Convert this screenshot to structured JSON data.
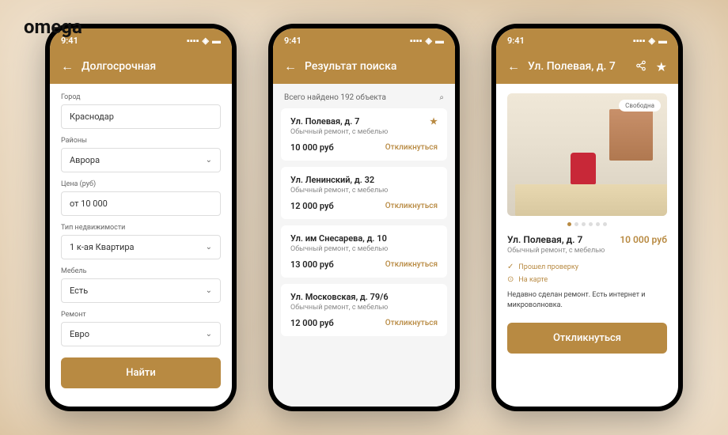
{
  "logo": "omega",
  "status": {
    "time": "9:41"
  },
  "screen1": {
    "title": "Долгосрочная",
    "fields": {
      "city": {
        "label": "Город",
        "value": "Краснодар"
      },
      "district": {
        "label": "Районы",
        "value": "Аврора"
      },
      "price": {
        "label": "Цена (руб)",
        "value": "от 10 000"
      },
      "type": {
        "label": "Тип недвижимости",
        "value": "1 к-ая Квартира"
      },
      "furniture": {
        "label": "Мебель",
        "value": "Есть"
      },
      "renovation": {
        "label": "Ремонт",
        "value": "Евро"
      }
    },
    "submit": "Найти"
  },
  "screen2": {
    "title": "Результат поиска",
    "summary": "Всего найдено 192 объекта",
    "items": [
      {
        "title": "Ул. Полевая, д. 7",
        "sub": "Обычный ремонт, с мебелью",
        "price": "10 000 руб",
        "action": "Откликнуться",
        "starred": true
      },
      {
        "title": "Ул. Ленинский, д. 32",
        "sub": "Обычный ремонт, с мебелью",
        "price": "12 000 руб",
        "action": "Откликнуться",
        "starred": false
      },
      {
        "title": "Ул. им Снесарева, д. 10",
        "sub": "Обычный ремонт, с мебелью",
        "price": "13 000 руб",
        "action": "Откликнуться",
        "starred": false
      },
      {
        "title": "Ул. Московская, д. 79/6",
        "sub": "Обычный ремонт, с мебелью",
        "price": "12 000 руб",
        "action": "Откликнуться",
        "starred": false
      }
    ]
  },
  "screen3": {
    "title": "Ул. Полевая, д. 7",
    "badge": "Свободна",
    "detail_title": "Ул. Полевая, д. 7",
    "detail_price": "10 000 руб",
    "detail_sub": "Обычный ремонт, с мебелью",
    "meta": [
      {
        "icon": "✓",
        "text": "Прошел проверку"
      },
      {
        "icon": "⊙",
        "text": "На карте"
      }
    ],
    "desc": "Недавно сделан ремонт. Есть интернет и микроволновка.",
    "cta": "Откликнуться"
  }
}
